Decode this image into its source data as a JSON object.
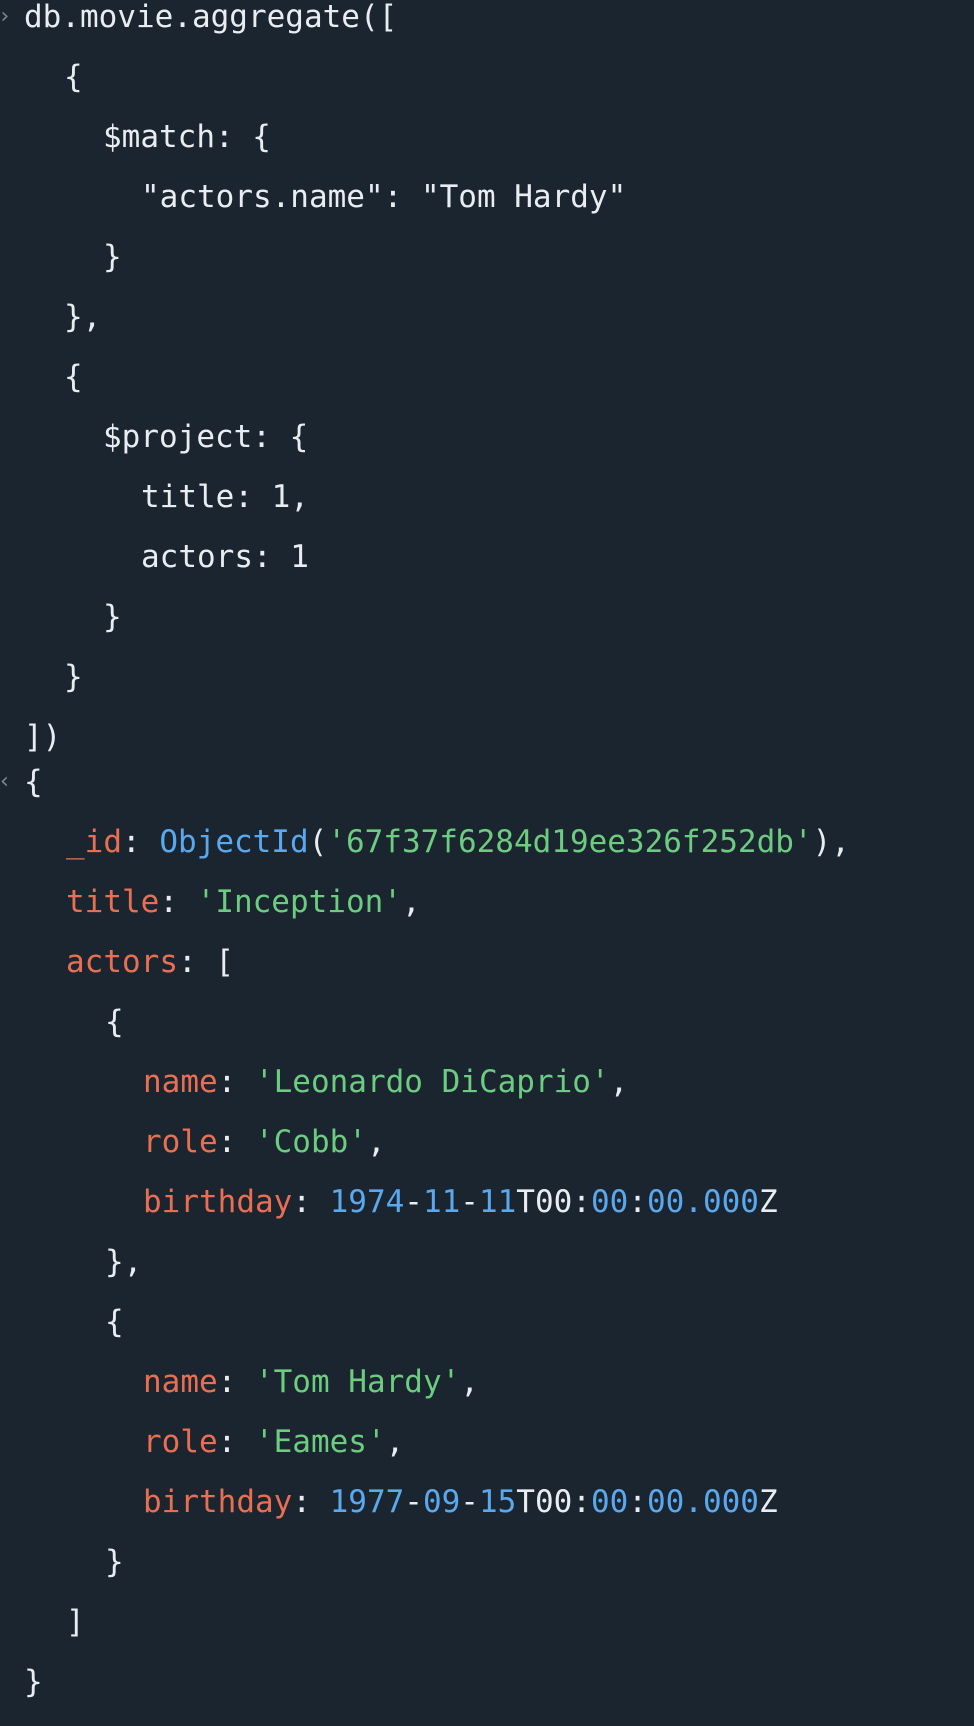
{
  "colors": {
    "background": "#1b2530",
    "text": "#e9edf1",
    "key": "#e96f52",
    "string": "#6ccc7f",
    "number": "#5aa9ef",
    "prompt": "#7c8894"
  },
  "input": {
    "prompt_icon": "chevron-right-icon",
    "lines": [
      "db.movie.aggregate([",
      "{",
      "$match: {",
      "\"actors.name\": \"Tom Hardy\"",
      "}",
      "},",
      "{",
      "$project: {",
      "title: 1,",
      "actors: 1",
      "}",
      "}",
      "])"
    ]
  },
  "output": {
    "prompt_icon": "chevron-left-icon",
    "open": "{",
    "close": "}",
    "id_key": "_id",
    "id_fn": "ObjectId",
    "id_value": "'67f37f6284d19ee326f252db'",
    "title_key": "title",
    "title_value": "'Inception'",
    "actors_key": "actors",
    "actors_open": "[",
    "actors_close": "]",
    "actors": [
      {
        "name_key": "name",
        "name": "'Leonardo DiCaprio'",
        "role_key": "role",
        "role": "'Cobb'",
        "birthday_key": "birthday",
        "birthday_year": "1974",
        "birthday_month": "11",
        "birthday_day": "11",
        "birthday_hour": "00",
        "birthday_minute": "00",
        "birthday_second": "00.000"
      },
      {
        "name_key": "name",
        "name": "'Tom Hardy'",
        "role_key": "role",
        "role": "'Eames'",
        "birthday_key": "birthday",
        "birthday_year": "1977",
        "birthday_month": "09",
        "birthday_day": "15",
        "birthday_hour": "00",
        "birthday_minute": "00",
        "birthday_second": "00.000"
      }
    ]
  }
}
